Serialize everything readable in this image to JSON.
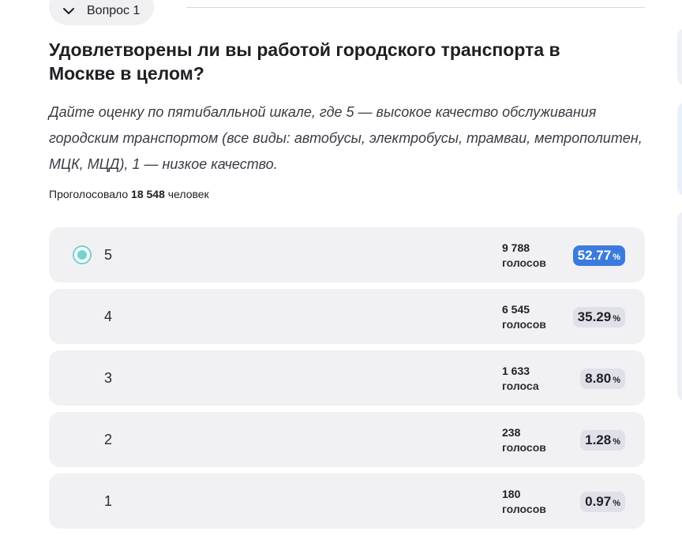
{
  "question": {
    "label": "Вопрос 1",
    "title": "Удовлетворены ли вы работой городского транспорта в Москве в целом?",
    "description": "Дайте оценку по пятибалльной шкале, где 5 — высокое качество обслуживания городским транспортом (все виды: автобусы, электробусы, трамваи, метрополитен, МЦК, МЦД), 1 — низкое качество.",
    "voted_prefix": "Проголосовало",
    "voted_count": "18 548",
    "voted_suffix": "человек"
  },
  "options": [
    {
      "label": "5",
      "votes": "9 788",
      "word": "голосов",
      "percent": "52.77",
      "sign": "%"
    },
    {
      "label": "4",
      "votes": "6 545",
      "word": "голосов",
      "percent": "35.29",
      "sign": "%"
    },
    {
      "label": "3",
      "votes": "1 633",
      "word": "голоса",
      "percent": "8.80",
      "sign": "%"
    },
    {
      "label": "2",
      "votes": "238",
      "word": "голосов",
      "percent": "1.28",
      "sign": "%"
    },
    {
      "label": "1",
      "votes": "180",
      "word": "голосов",
      "percent": "0.97",
      "sign": "%"
    }
  ],
  "colors": {
    "accent": "#3b7bde",
    "radio": "#6fd3d0",
    "option_bg": "#f1f1f4"
  },
  "icons": {
    "collapse": "chevron-down-icon"
  }
}
